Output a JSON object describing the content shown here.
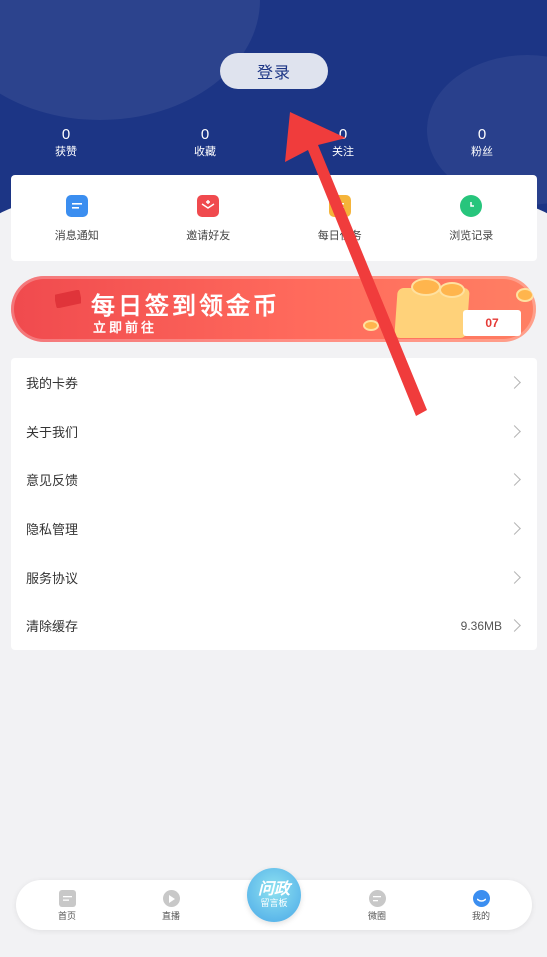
{
  "header": {
    "login_label": "登录",
    "stats": [
      {
        "value": "0",
        "label": "获赞"
      },
      {
        "value": "0",
        "label": "收藏"
      },
      {
        "value": "0",
        "label": "关注"
      },
      {
        "value": "0",
        "label": "粉丝"
      }
    ]
  },
  "quick_actions": [
    {
      "label": "消息通知",
      "icon": "message-icon",
      "color": "#3b8ef0"
    },
    {
      "label": "邀请好友",
      "icon": "red-envelope-icon",
      "color": "#f04a4e"
    },
    {
      "label": "每日任务",
      "icon": "task-icon",
      "color": "#f5b43a"
    },
    {
      "label": "浏览记录",
      "icon": "clock-icon",
      "color": "#27c57c"
    }
  ],
  "banner": {
    "title": "每日签到领金币",
    "subtitle": "立即前往",
    "calendar_day": "07"
  },
  "menu": [
    {
      "label": "我的卡券",
      "value": ""
    },
    {
      "label": "关于我们",
      "value": ""
    },
    {
      "label": "意见反馈",
      "value": ""
    },
    {
      "label": "隐私管理",
      "value": ""
    },
    {
      "label": "服务协议",
      "value": ""
    },
    {
      "label": "清除缓存",
      "value": "9.36MB"
    }
  ],
  "tabbar": {
    "tabs": [
      {
        "label": "首页",
        "icon": "home-icon"
      },
      {
        "label": "直播",
        "icon": "play-icon"
      },
      {
        "label": "微圈",
        "icon": "chat-icon"
      },
      {
        "label": "我的",
        "icon": "profile-icon",
        "active_color": "#3b8ef0"
      }
    ],
    "center_line1": "问政",
    "center_line2": "留言板"
  },
  "colors": {
    "header_bg": "#1c3585",
    "arrow": "#f03c3c"
  }
}
